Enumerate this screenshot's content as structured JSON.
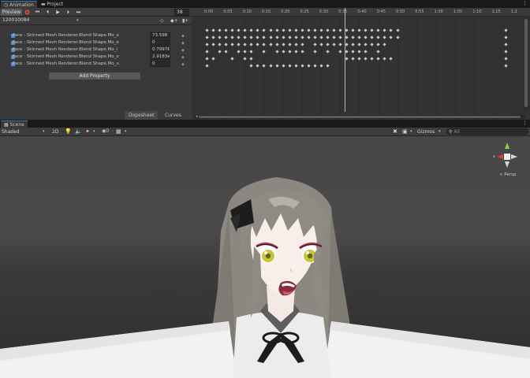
{
  "tabs": {
    "animation": "Animation",
    "project": "Project",
    "scene": "Scene"
  },
  "toolbar": {
    "preview": "Preview",
    "frame": "38"
  },
  "clip": {
    "name": "120010084"
  },
  "properties": [
    {
      "label": "Face : Skinned Mesh Renderer.Blend Shape.Mo_a",
      "value": "73.598"
    },
    {
      "label": "Face : Skinned Mesh Renderer.Blend Shape.Mo_e",
      "value": "0"
    },
    {
      "label": "Face : Skinned Mesh Renderer.Blend Shape.Mo_i",
      "value": "0.7997€"
    },
    {
      "label": "Face : Skinned Mesh Renderer.Blend Shape.Mo_o",
      "value": "2.9183e"
    },
    {
      "label": "Face : Skinned Mesh Renderer.Blend Shape.Mo_u",
      "value": "0"
    }
  ],
  "add_property": "Add Property",
  "bottom_tabs": {
    "dopesheet": "Dopesheet",
    "curves": "Curves"
  },
  "ruler": [
    "0:00",
    "0:05",
    "0:10",
    "0:15",
    "0:20",
    "0:25",
    "0:30",
    "0:35",
    "0:40",
    "0:45",
    "0:50",
    "0:55",
    "1:00",
    "1:05",
    "1:10",
    "1:15",
    "1:2"
  ],
  "scene_toolbar": {
    "shading": "Shaded",
    "mode2d": "2D",
    "gizmos": "Gizmos",
    "search_placeholder": "All"
  },
  "gizmo": {
    "persp": "< Persp",
    "axis_x": "x"
  },
  "colors": {
    "accent": "#3a79bb",
    "panel": "#383838",
    "dark": "#191919"
  }
}
